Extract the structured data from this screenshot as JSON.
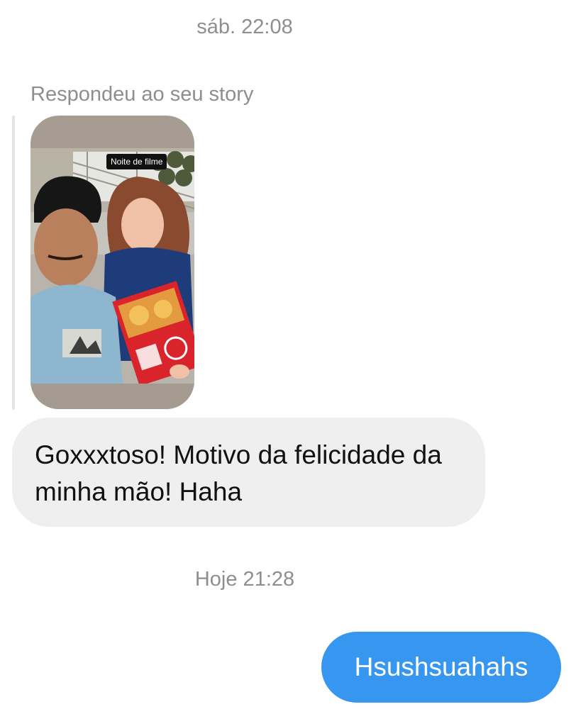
{
  "conversation": {
    "timestamp_1": "sáb. 22:08",
    "story_reply": {
      "label": "Respondeu ao seu story",
      "story_tag": "Noite de filme",
      "image_icon": "story-photo-selfie-with-pizza"
    },
    "incoming_message": "Goxxxtoso! Motivo da felicidade da minha mão! Haha",
    "timestamp_2": "Hoje 21:28",
    "outgoing_message": "Hsushsuahahs"
  },
  "colors": {
    "background": "#ffffff",
    "muted_text": "#8e8e8e",
    "incoming_bubble": "#efefef",
    "outgoing_bubble": "#3797f0",
    "outgoing_text": "#ffffff"
  }
}
